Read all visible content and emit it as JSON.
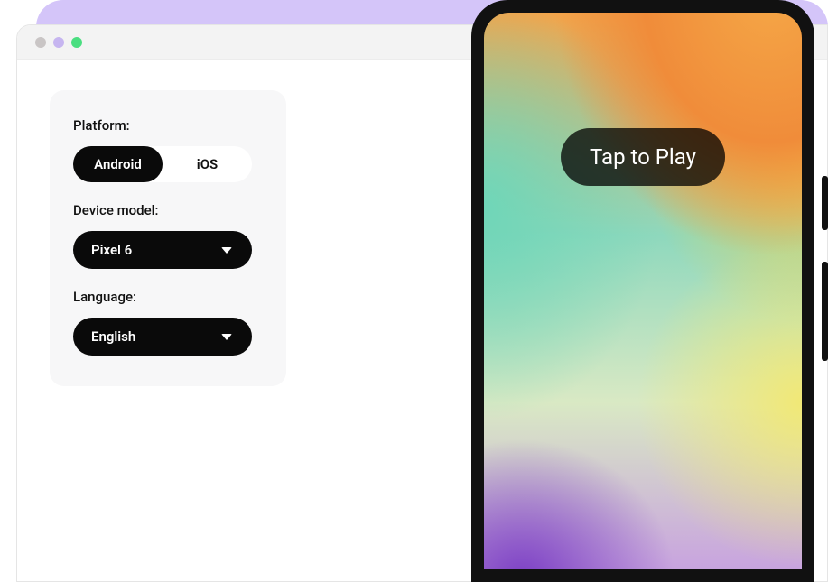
{
  "config": {
    "platform_label": "Platform:",
    "platform_options": [
      "Android",
      "iOS"
    ],
    "platform_selected": "Android",
    "device_label": "Device model:",
    "device_selected": "Pixel 6",
    "language_label": "Language:",
    "language_selected": "English"
  },
  "phone": {
    "tap_play": "Tap to Play"
  }
}
